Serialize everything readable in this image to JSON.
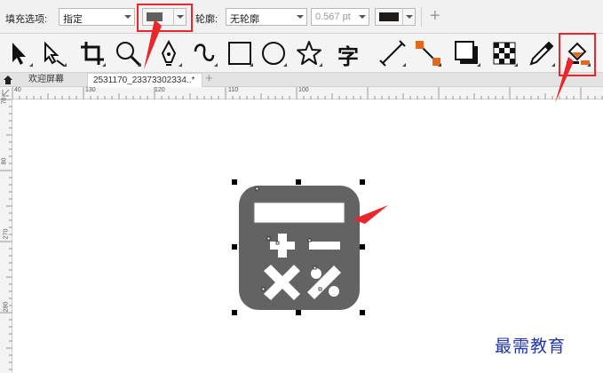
{
  "property_bar": {
    "fill_label": "填充选项:",
    "fill_mode": "指定",
    "fill_color": "#5f5f5f",
    "outline_label": "轮廓:",
    "outline_mode": "无轮廓",
    "outline_width": "0.567 pt",
    "outline_color": "#1e1a1a",
    "add_label": "+"
  },
  "toolbox": {
    "tools": [
      "pick-tool-icon",
      "shape-tool-icon",
      "crop-tool-icon",
      "zoom-tool-icon",
      "pen-tool-icon",
      "artistic-media-icon",
      "rectangle-tool-icon",
      "ellipse-tool-icon",
      "star-tool-icon",
      "text-tool-icon",
      "dimension-tool-icon",
      "connector-tool-icon",
      "drop-shadow-icon",
      "transparency-icon",
      "eyedropper-icon",
      "interactive-fill-icon"
    ],
    "text_tool_glyph": "字"
  },
  "tabs": {
    "home_label": "欢迎屏幕",
    "doc_label": "2531170_23373302334..*"
  },
  "rulers": {
    "h_labels": [
      "40",
      "130",
      "120",
      "110",
      "100"
    ],
    "v_labels": [
      "70",
      "80",
      "270",
      "280"
    ]
  },
  "watermark": "最需教育",
  "colors": {
    "accent": "#e8262b",
    "icon_fill": "#636363",
    "selection_handle": "#000000"
  }
}
